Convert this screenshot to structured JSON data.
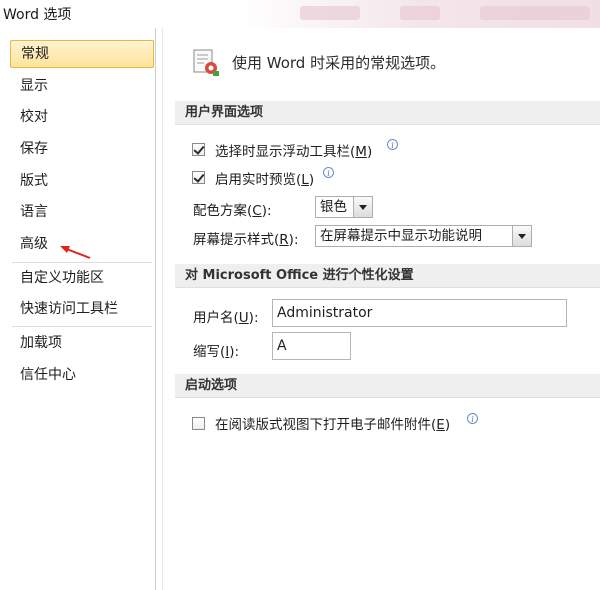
{
  "window": {
    "title": "Word 选项"
  },
  "sidebar": {
    "items": [
      {
        "label": "常规",
        "selected": true
      },
      {
        "label": "显示"
      },
      {
        "label": "校对"
      },
      {
        "label": "保存"
      },
      {
        "label": "版式"
      },
      {
        "label": "语言"
      },
      {
        "label": "高级"
      },
      {
        "label": "自定义功能区"
      },
      {
        "label": "快速访问工具栏"
      },
      {
        "label": "加载项"
      },
      {
        "label": "信任中心"
      }
    ]
  },
  "header": {
    "text": "使用 Word 时采用的常规选项。",
    "icon": "general-options-icon"
  },
  "ui_section": {
    "title": "用户界面选项",
    "mini_toolbar": {
      "label": "选择时显示浮动工具栏(",
      "key": "M",
      "suffix": ")",
      "checked": true
    },
    "live_preview": {
      "label": "启用实时预览(",
      "key": "L",
      "suffix": ")",
      "checked": true
    },
    "color_scheme": {
      "label": "配色方案(",
      "key": "C",
      "suffix": "):",
      "value": "银色"
    },
    "screentip": {
      "label": "屏幕提示样式(",
      "key": "R",
      "suffix": "):",
      "value": "在屏幕提示中显示功能说明"
    }
  },
  "personalize_section": {
    "title": "对 Microsoft Office 进行个性化设置",
    "username": {
      "label": "用户名(",
      "key": "U",
      "suffix": "):",
      "value": "Administrator"
    },
    "initials": {
      "label": "缩写(",
      "key": "I",
      "suffix": "):",
      "value": "A"
    }
  },
  "startup_section": {
    "title": "启动选项",
    "open_attachments": {
      "label": "在阅读版式视图下打开电子邮件附件(",
      "key": "E",
      "suffix": ")",
      "checked": false
    }
  },
  "colors": {
    "selected_bg": "#fde39a",
    "selected_border": "#e6b84a",
    "arrow": "#e0241b"
  }
}
